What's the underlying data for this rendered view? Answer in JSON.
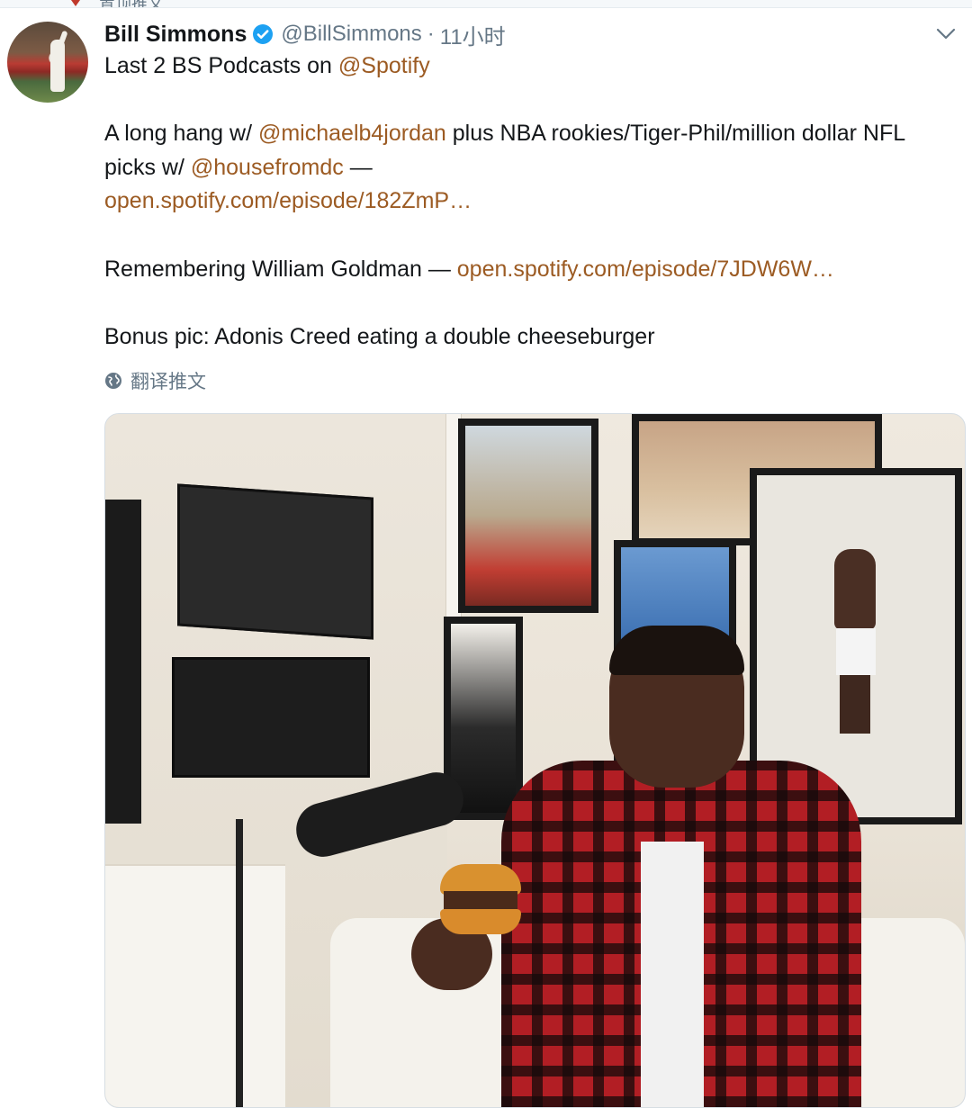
{
  "top_strip": {
    "cut_text": "置顶推文"
  },
  "tweet": {
    "author": {
      "name": "Bill Simmons",
      "handle": "@BillSimmons",
      "separator": "·",
      "timestamp": "11小时",
      "verified": true
    },
    "lines": {
      "l1_text": "Last 2 BS Podcasts on ",
      "l1_mention": "@Spotify",
      "l2_text_a": "A long hang w/ ",
      "l2_mention": "@michaelb4jordan",
      "l2_text_b": " plus NBA rookies/Tiger-Phil/million dollar NFL picks w/ ",
      "l2_mention2": "@housefromdc",
      "l2_dash": " —",
      "l2_link": "open.spotify.com/episode/182ZmP…",
      "l3_text": "Remembering William Goldman — ",
      "l3_link": "open.spotify.com/episode/7JDW6W…",
      "l4_text": "Bonus pic: Adonis Creed eating a double cheeseburger"
    },
    "translate_label": "翻译推文"
  },
  "colors": {
    "link": "#9c5b23",
    "text": "#14171a",
    "muted": "#657786",
    "verified": "#1da1f2"
  },
  "icons": {
    "verified": "verified-badge-icon",
    "menu": "chevron-down-icon",
    "translate": "globe-icon"
  }
}
